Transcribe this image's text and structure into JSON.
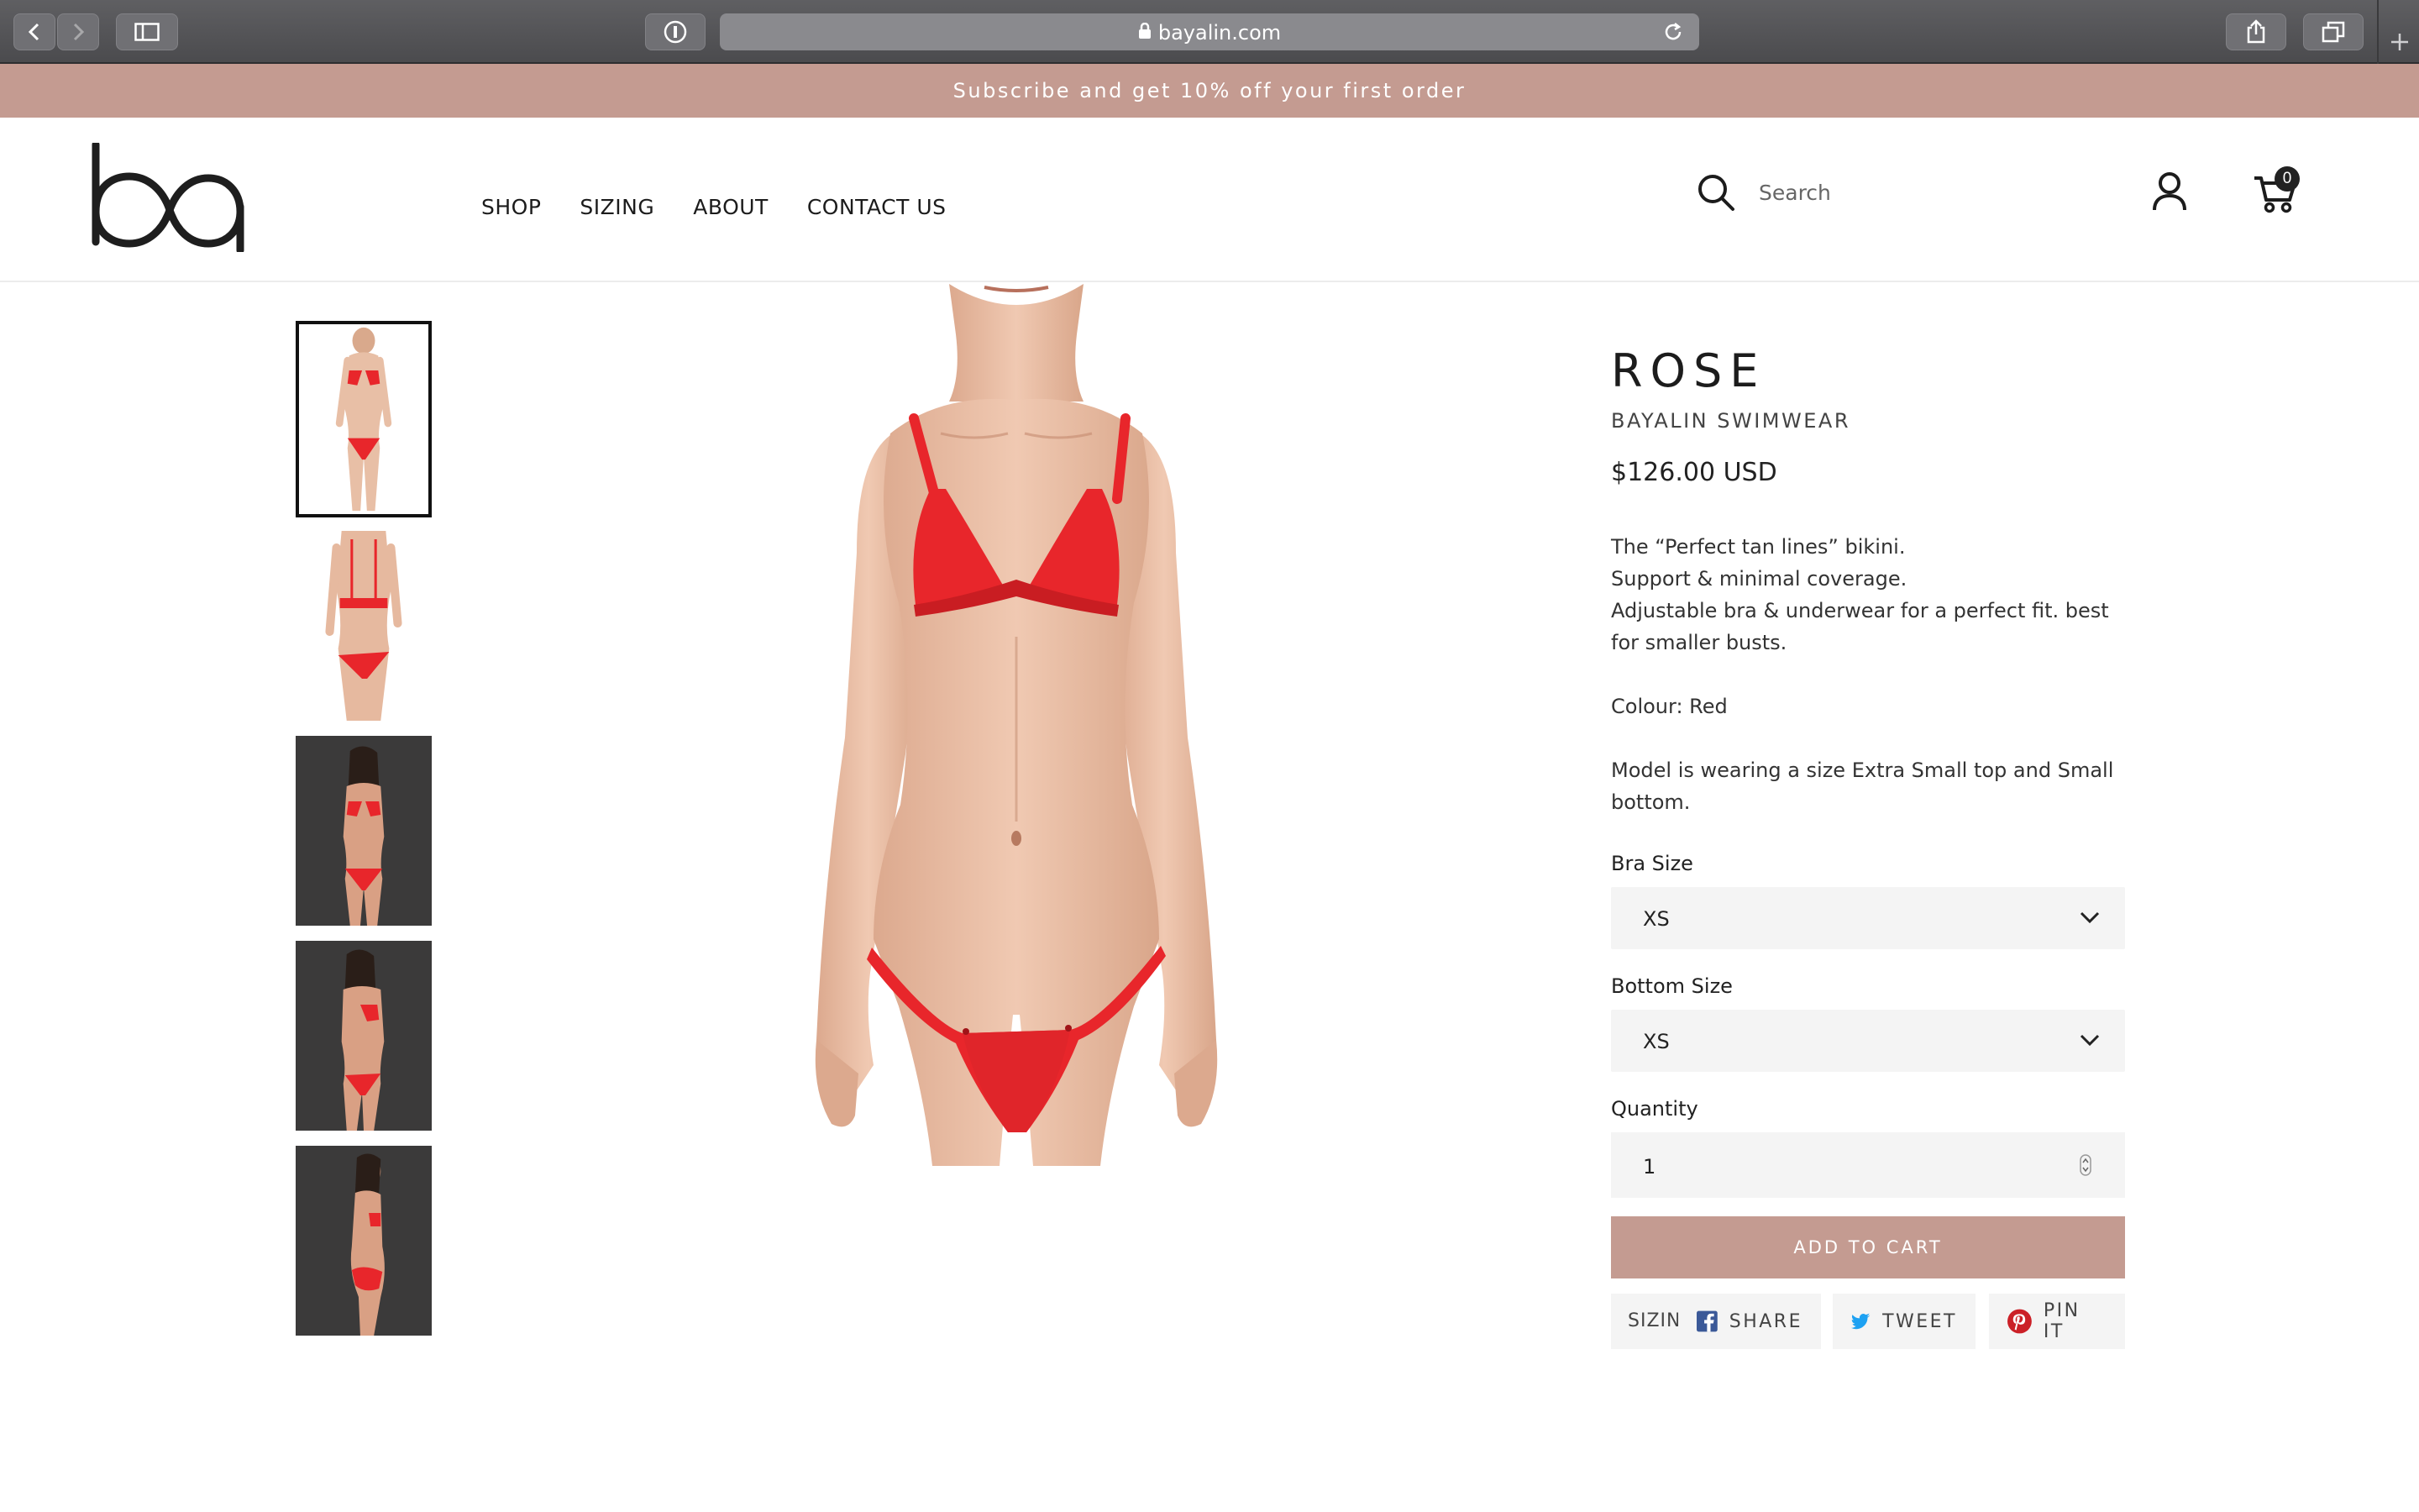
{
  "browser": {
    "url": "bayalin.com"
  },
  "promo": {
    "text": "Subscribe and get 10% off your first order"
  },
  "header": {
    "logo_text": "ba",
    "nav": [
      "SHOP",
      "SIZING",
      "ABOUT",
      "CONTACT US"
    ],
    "search_placeholder": "Search",
    "cart_count": "0"
  },
  "product": {
    "title": "ROSE",
    "vendor": "BAYALIN SWIMWEAR",
    "price": "$126.00 USD",
    "description": [
      "The “Perfect tan lines” bikini.",
      "Support & minimal coverage.",
      "Adjustable bra & underwear for a perfect fit. best for smaller busts."
    ],
    "colour": "Colour: Red",
    "model_note": "Model is wearing a size Extra Small top and Small bottom.",
    "bra_size_label": "Bra Size",
    "bra_size_value": "XS",
    "bottom_size_label": "Bottom Size",
    "bottom_size_value": "XS",
    "quantity_label": "Quantity",
    "quantity_value": "1",
    "add_to_cart": "ADD TO CART",
    "sizing_link": "SIZING",
    "share": "SHARE",
    "tweet": "TWEET",
    "pin": "PIN IT"
  },
  "colors": {
    "accent": "#c49b91",
    "bikini_red": "#e8262b",
    "skin": "#e8bfa6",
    "dark_bg": "#3b3a3a"
  }
}
